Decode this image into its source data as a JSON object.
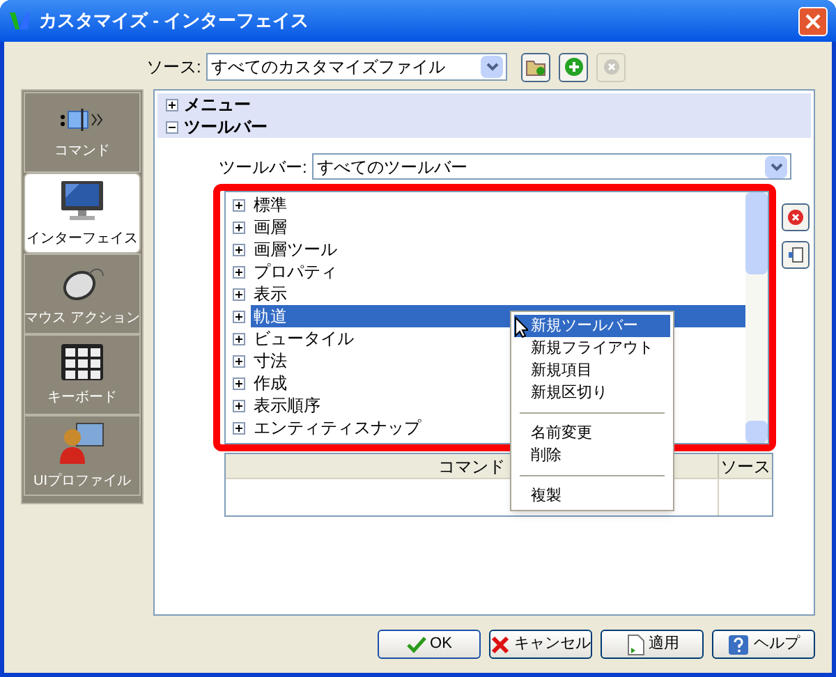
{
  "window": {
    "title": "カスタマイズ - インターフェイス"
  },
  "source": {
    "label": "ソース:",
    "value": "すべてのカスタマイズファイル"
  },
  "sidebar": {
    "items": [
      {
        "label": "コマンド",
        "selected": false
      },
      {
        "label": "インターフェイス",
        "selected": true
      },
      {
        "label": "マウス アクション",
        "selected": false
      },
      {
        "label": "キーボード",
        "selected": false
      },
      {
        "label": "UIプロファイル",
        "selected": false
      }
    ]
  },
  "categories": [
    {
      "label": "メニュー",
      "expanded": false
    },
    {
      "label": "ツールバー",
      "expanded": true
    }
  ],
  "toolbar_filter": {
    "label": "ツールバー:",
    "value": "すべてのツールバー"
  },
  "toolbars": [
    {
      "label": "標準",
      "selected": false
    },
    {
      "label": "画層",
      "selected": false
    },
    {
      "label": "画層ツール",
      "selected": false
    },
    {
      "label": "プロパティ",
      "selected": false
    },
    {
      "label": "表示",
      "selected": false
    },
    {
      "label": "軌道",
      "selected": true
    },
    {
      "label": "ビュータイル",
      "selected": false
    },
    {
      "label": "寸法",
      "selected": false
    },
    {
      "label": "作成",
      "selected": false
    },
    {
      "label": "表示順序",
      "selected": false
    },
    {
      "label": "エンティティスナップ",
      "selected": false
    }
  ],
  "context_menu": {
    "items": [
      {
        "kind": "item",
        "label": "新規ツールバー",
        "selected": true
      },
      {
        "kind": "item",
        "label": "新規フライアウト",
        "selected": false
      },
      {
        "kind": "item",
        "label": "新規項目",
        "selected": false
      },
      {
        "kind": "item",
        "label": "新規区切り",
        "selected": false
      },
      {
        "kind": "separator"
      },
      {
        "kind": "item",
        "label": "名前変更",
        "selected": false
      },
      {
        "kind": "item",
        "label": "削除",
        "selected": false
      },
      {
        "kind": "separator"
      },
      {
        "kind": "item",
        "label": "複製",
        "selected": false
      }
    ]
  },
  "table": {
    "columns": [
      "コマンド",
      "ソース"
    ]
  },
  "buttons": [
    {
      "kind": "ok",
      "label": "OK"
    },
    {
      "kind": "cancel",
      "label": "キャンセル"
    },
    {
      "kind": "apply",
      "label": "適用"
    },
    {
      "kind": "help",
      "label": "ヘルプ"
    }
  ]
}
